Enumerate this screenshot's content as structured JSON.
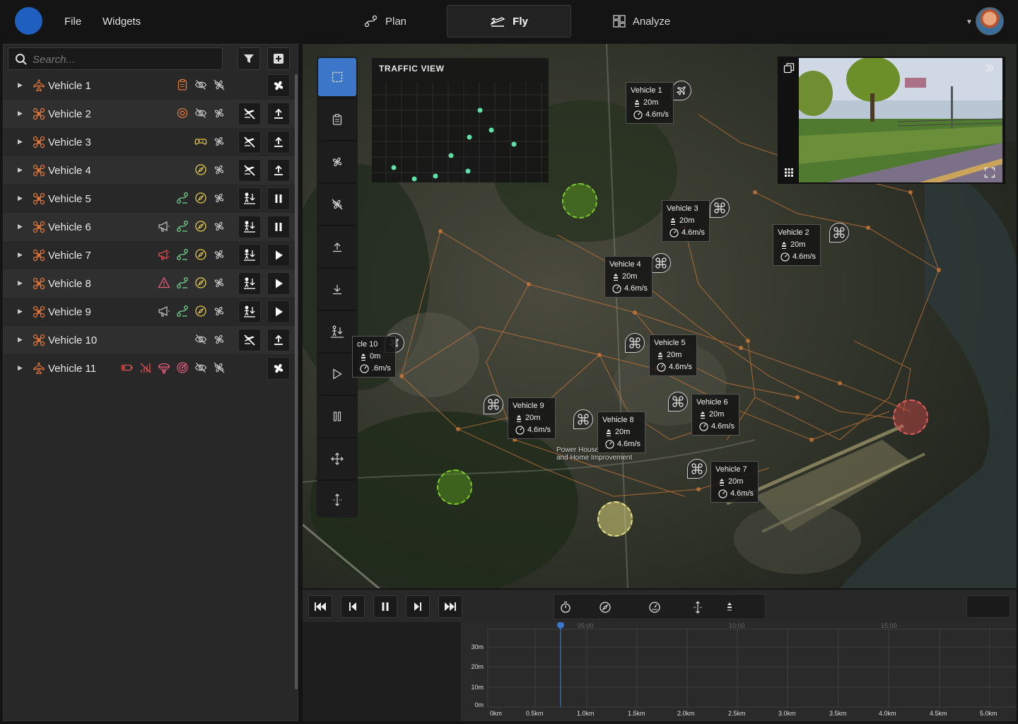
{
  "menu": {
    "file": "File",
    "widgets": "Widgets"
  },
  "modes": [
    {
      "label": "Plan",
      "icon": "route-icon",
      "active": false
    },
    {
      "label": "Fly",
      "icon": "plane-icon",
      "active": true
    },
    {
      "label": "Analyze",
      "icon": "dashboard-icon",
      "active": false
    }
  ],
  "search": {
    "placeholder": "Search..."
  },
  "vehicles": [
    {
      "name": "Vehicle 1",
      "type": "plane",
      "statuses": [
        "clipboard",
        "eye-off",
        "fan-off"
      ],
      "action": "fan",
      "action2": null
    },
    {
      "name": "Vehicle 2",
      "type": "drone",
      "statuses": [
        "target-orange",
        "eye-off",
        "fan"
      ],
      "action": "no-fly",
      "action2": "takeoff"
    },
    {
      "name": "Vehicle 3",
      "type": "drone",
      "statuses": [
        "gamepad",
        "fan"
      ],
      "action": "no-fly",
      "action2": "takeoff"
    },
    {
      "name": "Vehicle 4",
      "type": "drone",
      "statuses": [
        "compass",
        "fan"
      ],
      "action": "no-fly",
      "action2": "takeoff"
    },
    {
      "name": "Vehicle 5",
      "type": "drone",
      "statuses": [
        "route",
        "compass",
        "fan"
      ],
      "action": "land",
      "action2": "pause"
    },
    {
      "name": "Vehicle 6",
      "type": "drone",
      "statuses": [
        "megaphone-grey",
        "route",
        "compass",
        "fan"
      ],
      "action": "land",
      "action2": "pause"
    },
    {
      "name": "Vehicle 7",
      "type": "drone",
      "statuses": [
        "megaphone-red",
        "route",
        "compass",
        "fan"
      ],
      "action": "land",
      "action2": "play"
    },
    {
      "name": "Vehicle 8",
      "type": "drone",
      "statuses": [
        "warning",
        "route",
        "compass",
        "fan"
      ],
      "action": "land",
      "action2": "play"
    },
    {
      "name": "Vehicle 9",
      "type": "drone",
      "statuses": [
        "megaphone-grey",
        "route",
        "compass",
        "fan"
      ],
      "action": "land",
      "action2": "play"
    },
    {
      "name": "Vehicle 10",
      "type": "drone",
      "statuses": [
        "eye-off",
        "fan"
      ],
      "action": "no-fly",
      "action2": "takeoff"
    },
    {
      "name": "Vehicle 11",
      "type": "plane",
      "statuses": [
        "battery-low",
        "signal-low",
        "parachute",
        "target-red",
        "eye-off",
        "fan-off"
      ],
      "action": "fan",
      "action2": null
    }
  ],
  "traffic": {
    "title": "TRAFFIC VIEW"
  },
  "map_labels": [
    {
      "name": "Vehicle 1",
      "alt": "20m",
      "speed": "4.6m/s"
    },
    {
      "name": "Vehicle 2",
      "alt": "20m",
      "speed": "4.6m/s"
    },
    {
      "name": "Vehicle 3",
      "alt": "20m",
      "speed": "4.6m/s"
    },
    {
      "name": "Vehicle 4",
      "alt": "20m",
      "speed": "4.6m/s"
    },
    {
      "name": "Vehicle 5",
      "alt": "20m",
      "speed": "4.6m/s"
    },
    {
      "name": "Vehicle 6",
      "alt": "20m",
      "speed": "4.6m/s"
    },
    {
      "name": "Vehicle 7",
      "alt": "20m",
      "speed": "4.6m/s"
    },
    {
      "name": "Vehicle 8",
      "alt": "20m",
      "speed": "4.6m/s"
    },
    {
      "name": "Vehicle 9",
      "alt": "20m",
      "speed": "4.6m/s"
    },
    {
      "name": "cle 10",
      "alt": "0m",
      "speed": ".6m/s"
    }
  ],
  "poi": {
    "line1": "Power House",
    "line2": "and Home Improvement"
  },
  "timeline": {
    "time_ticks": [
      "05:00",
      "10:00",
      "15:00"
    ],
    "y_ticks": [
      "30m",
      "20m",
      "10m",
      "0m"
    ],
    "x_ticks": [
      "0km",
      "0.5km",
      "1.0km",
      "1.5km",
      "2.0km",
      "2.5km",
      "3.0km",
      "3.5km",
      "4.0km",
      "4.5km",
      "5.0km"
    ]
  },
  "colors": {
    "accent": "#3c76c9",
    "route": "#c9773a",
    "zone_green": "#5aa31f",
    "zone_yellow": "#d8d27a",
    "zone_red": "#d04a4a"
  }
}
